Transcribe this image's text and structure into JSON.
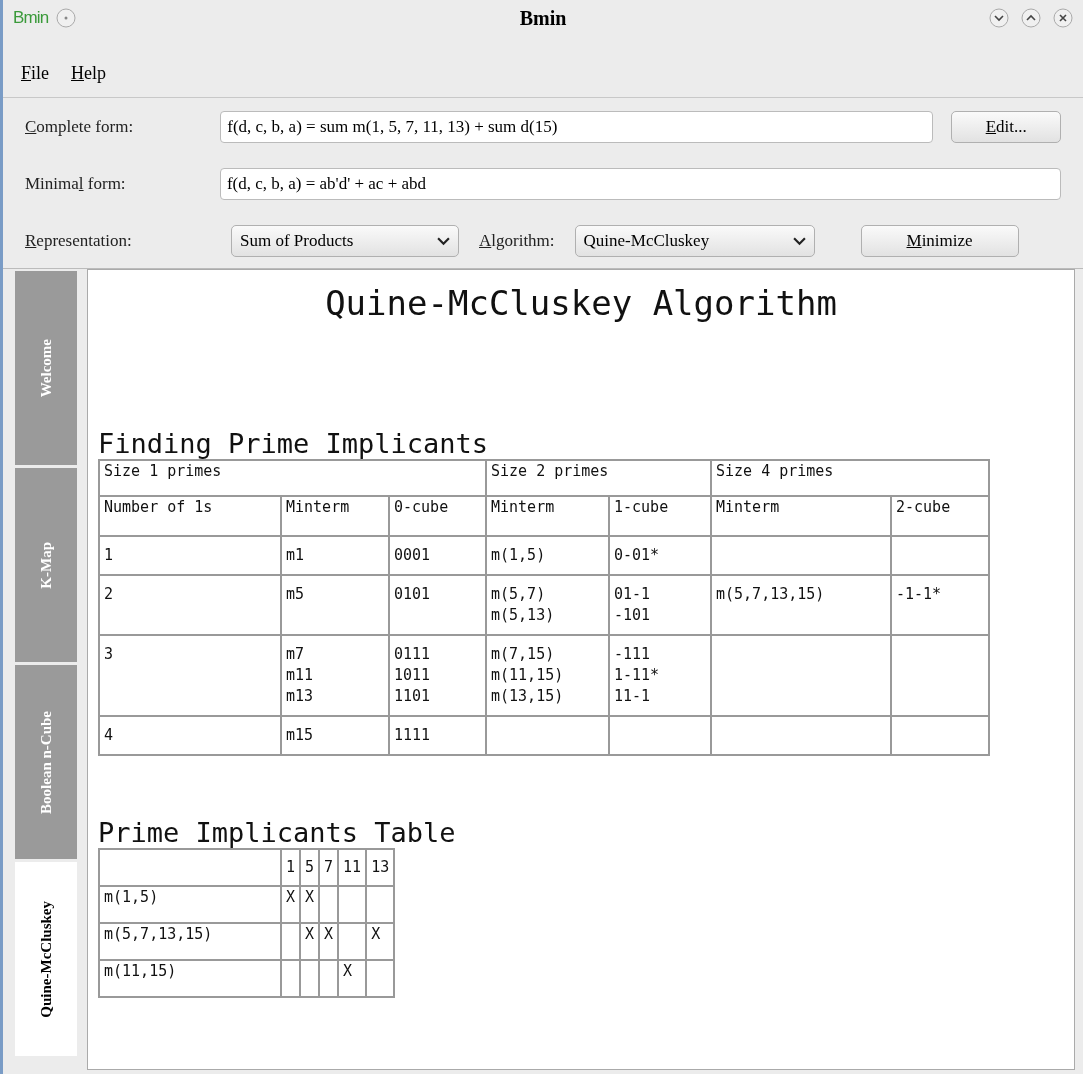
{
  "window": {
    "logo": "Bmin",
    "title": "Bmin"
  },
  "menu": [
    {
      "key": "F",
      "post": "ile"
    },
    {
      "key": "H",
      "post": "elp"
    }
  ],
  "complete_form": {
    "label": {
      "key": "C",
      "post": "omplete form:"
    },
    "value": "f(d, c, b, a) = sum m(1, 5, 7, 11, 13) + sum d(15)",
    "button": {
      "key": "E",
      "post": "dit..."
    }
  },
  "minimal_form": {
    "label": {
      "pre": "Minima",
      "key": "l",
      "post": " form:"
    },
    "value": "f(d, c, b, a) = ab'd' + ac + abd"
  },
  "representation": {
    "label": {
      "key": "R",
      "post": "epresentation:"
    },
    "value": "Sum of Products"
  },
  "algorithm": {
    "label": {
      "key": "A",
      "post": "lgorithm:"
    },
    "value": "Quine-McCluskey"
  },
  "minimize_button": {
    "key": "M",
    "post": "inimize"
  },
  "tabs": [
    {
      "label": "Welcome",
      "selected": false
    },
    {
      "label": "K-Map",
      "selected": false
    },
    {
      "label": "Boolean n-Cube",
      "selected": false
    },
    {
      "label": "Quine-McCluskey",
      "selected": true
    }
  ],
  "content": {
    "heading": "Quine-McCluskey Algorithm",
    "finding": {
      "title": "Finding Prime Implicants",
      "groups": [
        {
          "label": "Size 1 primes",
          "columns": [
            "Number of 1s",
            "Minterm",
            "0-cube"
          ]
        },
        {
          "label": "Size 2 primes",
          "columns": [
            "Minterm",
            "1-cube"
          ]
        },
        {
          "label": "Size 4 primes",
          "columns": [
            "Minterm",
            "2-cube"
          ]
        }
      ],
      "rows": [
        [
          [
            "1"
          ],
          [
            "m1"
          ],
          [
            "0001"
          ],
          [
            "m(1,5)"
          ],
          [
            "0-01*"
          ],
          [],
          []
        ],
        [
          [
            "2"
          ],
          [
            "m5"
          ],
          [
            "0101"
          ],
          [
            "m(5,7)",
            "m(5,13)"
          ],
          [
            "01-1",
            "-101"
          ],
          [
            "m(5,7,13,15)"
          ],
          [
            "-1-1*"
          ]
        ],
        [
          [
            "3"
          ],
          [
            "m7",
            "m11",
            "m13"
          ],
          [
            "0111",
            "1011",
            "1101"
          ],
          [
            "m(7,15)",
            "m(11,15)",
            "m(13,15)"
          ],
          [
            "-111",
            "1-11*",
            "11-1"
          ],
          [],
          []
        ],
        [
          [
            "4"
          ],
          [
            "m15"
          ],
          [
            "1111"
          ],
          [],
          [],
          [],
          []
        ]
      ]
    },
    "table": {
      "title": "Prime Implicants Table",
      "columns": [
        "1",
        "5",
        "7",
        "11",
        "13"
      ],
      "rows": [
        {
          "label": "m(1,5)",
          "cells": [
            [
              "X"
            ],
            [
              "X"
            ],
            [],
            [],
            []
          ]
        },
        {
          "label": "m(5,7,13,15)",
          "cells": [
            [],
            [
              "X"
            ],
            [
              "X"
            ],
            [],
            [
              "X"
            ]
          ]
        },
        {
          "label": "m(11,15)",
          "cells": [
            [],
            [],
            [],
            [
              "X"
            ],
            []
          ]
        }
      ]
    }
  }
}
